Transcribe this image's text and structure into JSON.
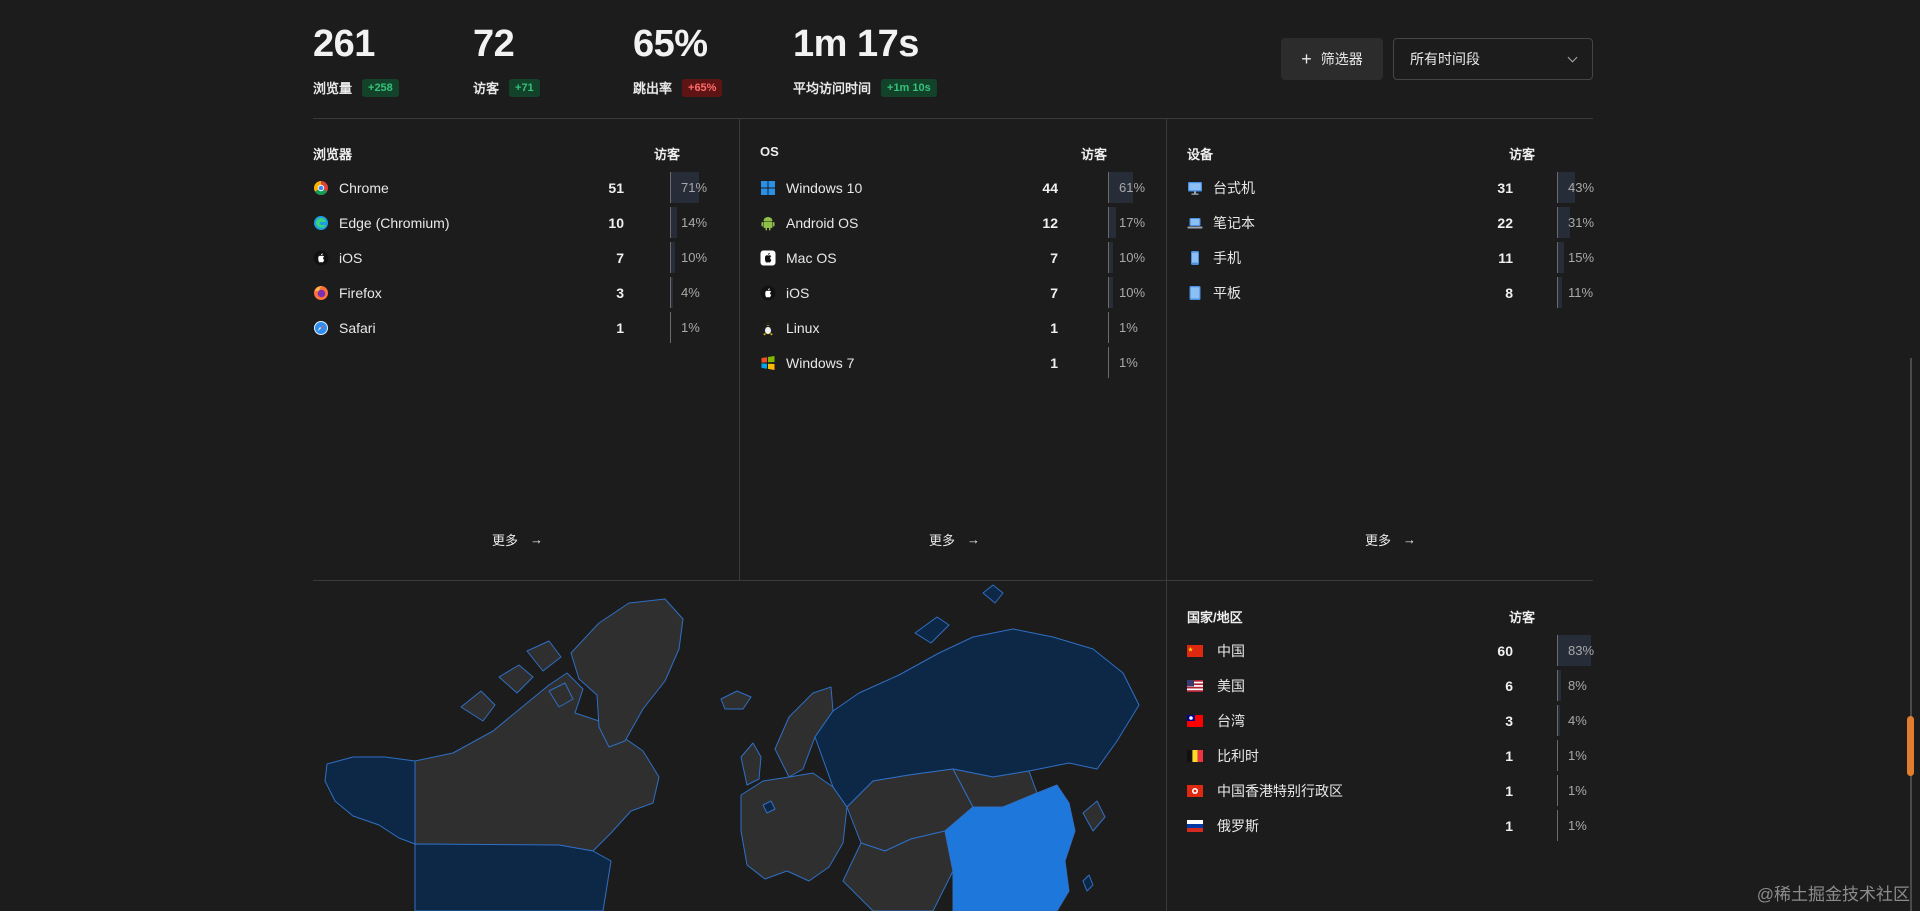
{
  "stats": [
    {
      "value": "261",
      "label": "浏览量",
      "change": "+258",
      "tone": "pos"
    },
    {
      "value": "72",
      "label": "访客",
      "change": "+71",
      "tone": "pos"
    },
    {
      "value": "65%",
      "label": "跳出率",
      "change": "+65%",
      "tone": "neg"
    },
    {
      "value": "1m 17s",
      "label": "平均访问时间",
      "change": "+1m 10s",
      "tone": "pos"
    }
  ],
  "toolbar": {
    "filter_label": "筛选器",
    "range_label": "所有时间段"
  },
  "panels": {
    "browser": {
      "title": "浏览器",
      "col": "访客",
      "more": "更多",
      "rows": [
        {
          "icon": "chrome-icon",
          "label": "Chrome",
          "count": "51",
          "pct": "71%",
          "fraction": 0.71
        },
        {
          "icon": "edge-icon",
          "label": "Edge (Chromium)",
          "count": "10",
          "pct": "14%",
          "fraction": 0.14
        },
        {
          "icon": "apple-icon",
          "label": "iOS",
          "count": "7",
          "pct": "10%",
          "fraction": 0.1
        },
        {
          "icon": "firefox-icon",
          "label": "Firefox",
          "count": "3",
          "pct": "4%",
          "fraction": 0.04
        },
        {
          "icon": "safari-icon",
          "label": "Safari",
          "count": "1",
          "pct": "1%",
          "fraction": 0.01
        }
      ]
    },
    "os": {
      "title": "OS",
      "col": "访客",
      "more": "更多",
      "rows": [
        {
          "icon": "windows-icon",
          "label": "Windows 10",
          "count": "44",
          "pct": "61%",
          "fraction": 0.61
        },
        {
          "icon": "android-icon",
          "label": "Android OS",
          "count": "12",
          "pct": "17%",
          "fraction": 0.17
        },
        {
          "icon": "macos-icon",
          "label": "Mac OS",
          "count": "7",
          "pct": "10%",
          "fraction": 0.1
        },
        {
          "icon": "apple-icon",
          "label": "iOS",
          "count": "7",
          "pct": "10%",
          "fraction": 0.1
        },
        {
          "icon": "linux-icon",
          "label": "Linux",
          "count": "1",
          "pct": "1%",
          "fraction": 0.01
        },
        {
          "icon": "windows7-icon",
          "label": "Windows 7",
          "count": "1",
          "pct": "1%",
          "fraction": 0.01
        }
      ]
    },
    "device": {
      "title": "设备",
      "col": "访客",
      "more": "更多",
      "rows": [
        {
          "icon": "desktop-icon",
          "label": "台式机",
          "count": "31",
          "pct": "43%",
          "fraction": 0.43
        },
        {
          "icon": "laptop-icon",
          "label": "笔记本",
          "count": "22",
          "pct": "31%",
          "fraction": 0.31
        },
        {
          "icon": "mobile-icon",
          "label": "手机",
          "count": "11",
          "pct": "15%",
          "fraction": 0.15
        },
        {
          "icon": "tablet-icon",
          "label": "平板",
          "count": "8",
          "pct": "11%",
          "fraction": 0.11
        }
      ]
    },
    "country": {
      "title": "国家/地区",
      "col": "访客",
      "rows": [
        {
          "icon": "flag-cn-icon",
          "label": "中国",
          "count": "60",
          "pct": "83%",
          "fraction": 0.83
        },
        {
          "icon": "flag-us-icon",
          "label": "美国",
          "count": "6",
          "pct": "8%",
          "fraction": 0.08
        },
        {
          "icon": "flag-tw-icon",
          "label": "台湾",
          "count": "3",
          "pct": "4%",
          "fraction": 0.04
        },
        {
          "icon": "flag-be-icon",
          "label": "比利时",
          "count": "1",
          "pct": "1%",
          "fraction": 0.01
        },
        {
          "icon": "flag-hk-icon",
          "label": "中国香港特别行政区",
          "count": "1",
          "pct": "1%",
          "fraction": 0.01
        },
        {
          "icon": "flag-ru-icon",
          "label": "俄罗斯",
          "count": "1",
          "pct": "1%",
          "fraction": 0.01
        }
      ]
    }
  },
  "watermark": "@稀土掘金技术社区",
  "colors": {
    "background": "#1c1c1c",
    "positive": "#37c07a",
    "negative": "#ff6b6b",
    "map_highlight": "#1e78dc",
    "map_low": "#0d2747",
    "map_none": "#2f2f2f"
  }
}
